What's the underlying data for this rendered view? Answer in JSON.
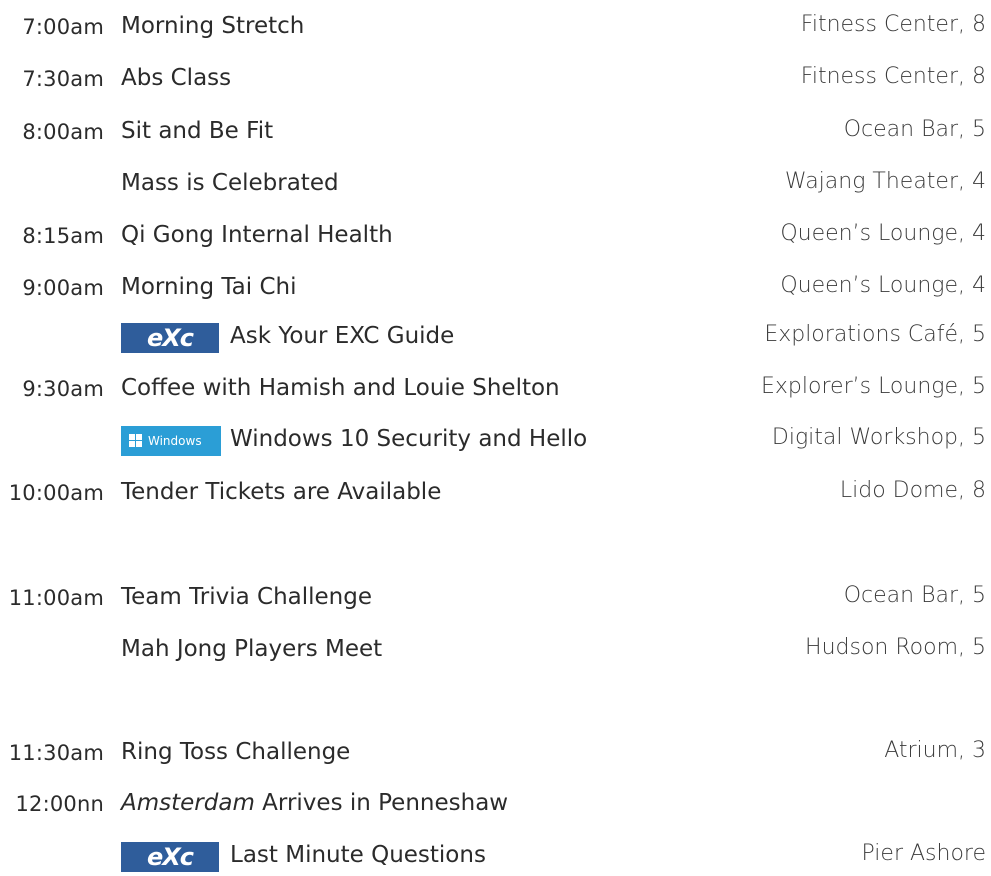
{
  "schedule": [
    {
      "time": "7:00am",
      "title": "Morning Stretch",
      "location": "Fitness Center, 8"
    },
    {
      "time": "7:30am",
      "title": "Abs Class",
      "location": "Fitness Center, 8"
    },
    {
      "time": "8:00am",
      "title": "Sit and Be Fit",
      "location": "Ocean Bar, 5"
    },
    {
      "time": "",
      "title": "Mass is Celebrated",
      "location": "Wajang Theater, 4"
    },
    {
      "time": "8:15am",
      "title": "Qi Gong Internal Health",
      "location": "Queen’s Lounge, 4"
    },
    {
      "time": "9:00am",
      "title": "Morning Tai Chi",
      "location": "Queen’s Lounge, 4"
    },
    {
      "time": "",
      "badge": "exc",
      "badge_text": "eXc",
      "title": "Ask Your EXC Guide",
      "location": "Explorations Café, 5"
    },
    {
      "time": "9:30am",
      "title": "Coffee with Hamish and Louie Shelton",
      "location": "Explorer’s Lounge, 5"
    },
    {
      "time": "",
      "badge": "windows",
      "badge_text": "Windows",
      "title": "Windows 10 Security and Hello",
      "location": "Digital Workshop, 5"
    },
    {
      "time": "10:00am",
      "title": "Tender Tickets are Available",
      "location": "Lido Dome, 8"
    },
    {
      "time": "11:00am",
      "title": "Team Trivia Challenge",
      "location": "Ocean Bar, 5"
    },
    {
      "time": "",
      "title": "Mah Jong Players Meet",
      "location": "Hudson Room, 5"
    },
    {
      "time": "11:30am",
      "title": "Ring Toss Challenge",
      "location": "Atrium, 3"
    },
    {
      "time": "12:00nn",
      "title_italic": "Amsterdam",
      "title": " Arrives in Penneshaw",
      "location": ""
    },
    {
      "time": "",
      "badge": "exc",
      "badge_text": "eXc",
      "title": "Last Minute Questions",
      "location": "Pier Ashore"
    }
  ],
  "colors": {
    "text": "#2b2b2b",
    "exc_badge": "#2f5d9b",
    "windows_badge": "#2b9ed6"
  }
}
